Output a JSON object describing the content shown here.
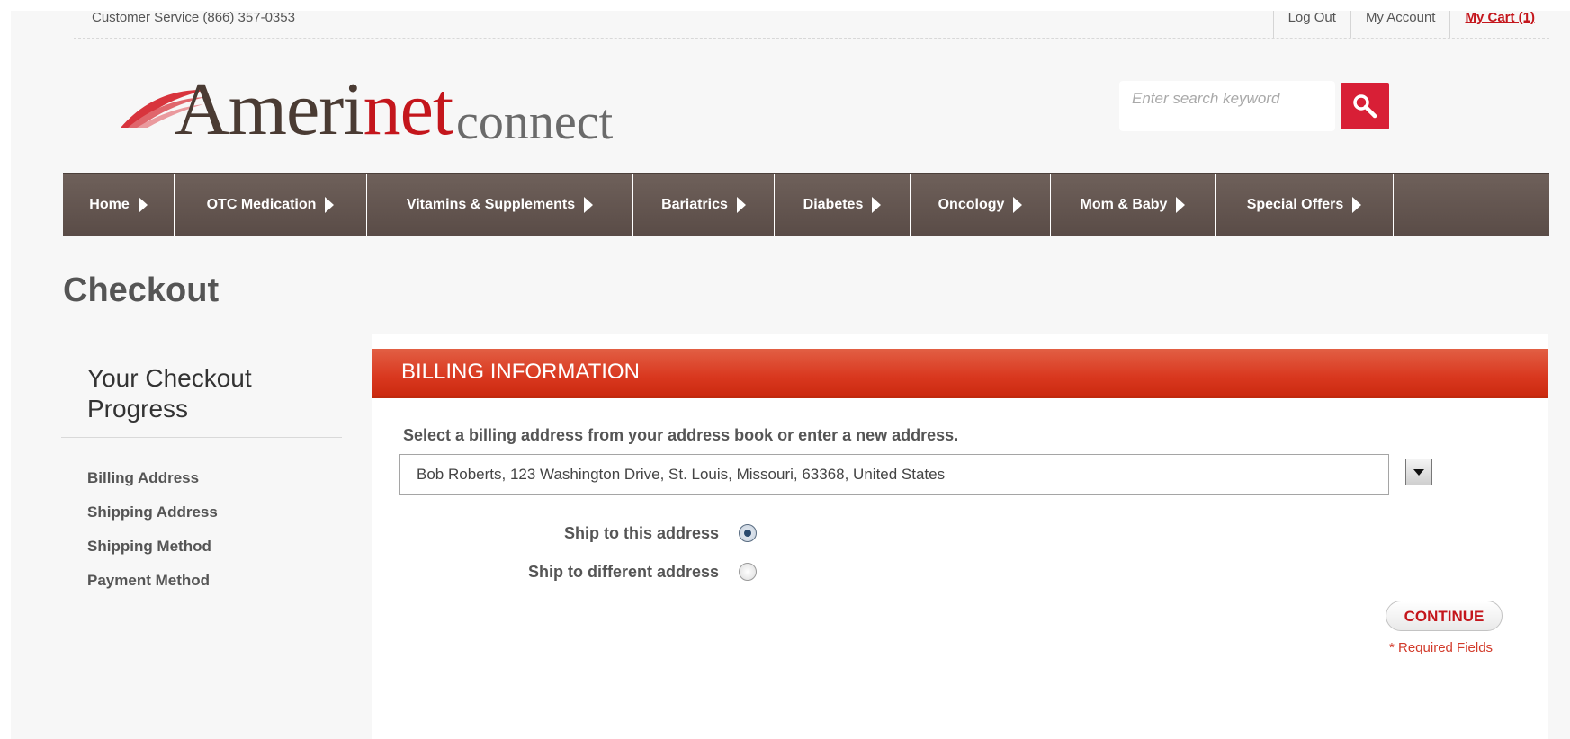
{
  "topbar": {
    "customer_service": "Customer Service (866) 357-0353",
    "links": [
      "Log Out",
      "My Account",
      "My Cart (1)"
    ]
  },
  "header": {
    "logo_main": "Ameri",
    "logo_red": "net",
    "logo_sub": "connect",
    "search_placeholder": "Enter search keyword"
  },
  "nav": {
    "items": [
      "Home",
      "OTC Medication",
      "Vitamins & Supplements",
      "Bariatrics",
      "Diabetes",
      "Oncology",
      "Mom & Baby",
      "Special Offers"
    ]
  },
  "page": {
    "title": "Checkout"
  },
  "sidebar": {
    "title": "Your Checkout Progress",
    "steps": [
      "Billing Address",
      "Shipping Address",
      "Shipping Method",
      "Payment Method"
    ]
  },
  "billing": {
    "section_title": "BILLING INFORMATION",
    "instruction": "Select a billing address from your address book or enter a new address.",
    "selected_address": "Bob Roberts, 123 Washington Drive, St. Louis, Missouri, 63368, United States",
    "options": [
      {
        "label": "Ship to this address",
        "checked": true
      },
      {
        "label": "Ship to different address",
        "checked": false
      }
    ],
    "continue_label": "CONTINUE",
    "required_note": "* Required Fields"
  }
}
